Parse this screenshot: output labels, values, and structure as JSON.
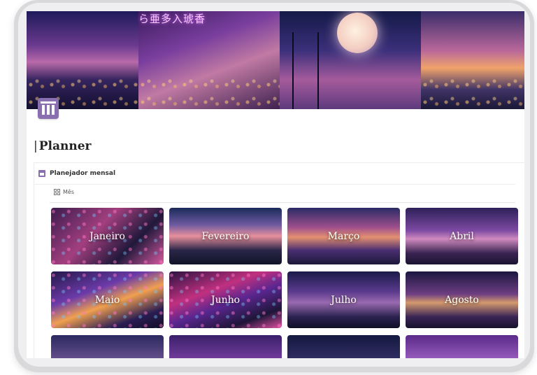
{
  "page": {
    "title": "Planner",
    "cover_neon_text": "ら亜多入琥香"
  },
  "database": {
    "title": "Planejador mensal",
    "view_label": "Mês"
  },
  "gallery": {
    "months": [
      "Janeiro",
      "Fevereiro",
      "Março",
      "Abril",
      "Maio",
      "Junho",
      "Julho",
      "Agosto",
      "",
      "",
      "",
      ""
    ]
  },
  "colors": {
    "accent": "#8a6fb0",
    "title_text": "#222222"
  },
  "icons": {
    "page": "calendar-icon",
    "database": "calendar-icon",
    "view": "gallery-grid-icon"
  }
}
